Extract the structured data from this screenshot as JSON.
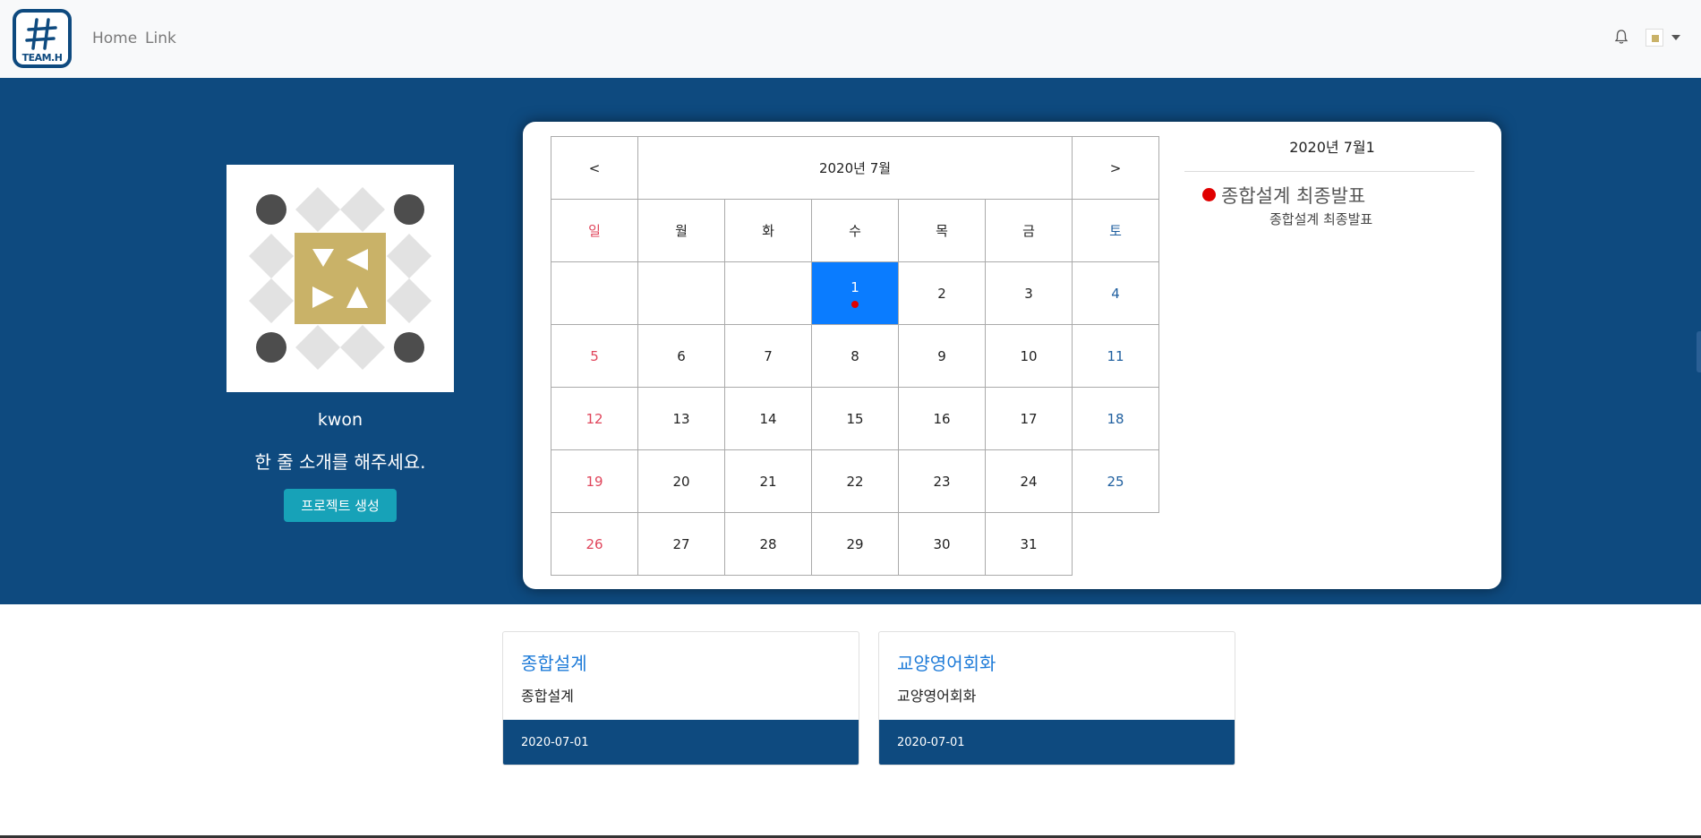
{
  "navbar": {
    "logo_text": "TEAM.H",
    "links": [
      "Home",
      "Link"
    ]
  },
  "profile": {
    "username": "kwon",
    "intro": "한 줄 소개를 해주세요.",
    "create_button": "프로젝트 생성"
  },
  "calendar": {
    "prev": "<",
    "next": ">",
    "month_title": "2020년 7월",
    "weekdays": [
      "일",
      "월",
      "화",
      "수",
      "목",
      "금",
      "토"
    ],
    "weeks": [
      [
        "",
        "",
        "",
        "1",
        "2",
        "3",
        "4"
      ],
      [
        "5",
        "6",
        "7",
        "8",
        "9",
        "10",
        "11"
      ],
      [
        "12",
        "13",
        "14",
        "15",
        "16",
        "17",
        "18"
      ],
      [
        "19",
        "20",
        "21",
        "22",
        "23",
        "24",
        "25"
      ],
      [
        "26",
        "27",
        "28",
        "29",
        "30",
        "31",
        ""
      ]
    ],
    "selected_day": "1",
    "event_days": [
      "1"
    ]
  },
  "schedule": {
    "date_title": "2020년 7월1",
    "event_name": "종합설계 최종발표",
    "event_desc": "종합설계 최종발표"
  },
  "projects": [
    {
      "title": "종합설계",
      "description": "종합설계",
      "date": "2020-07-01"
    },
    {
      "title": "교양영어회화",
      "description": "교양영어회화",
      "date": "2020-07-01"
    }
  ],
  "colors": {
    "primary": "#0e4a7f",
    "accent_button": "#17a2b8",
    "selected_day": "#0a7cff",
    "event_dot": "#e00000",
    "sunday": "#e0455b",
    "saturday": "#1f5f9f"
  }
}
